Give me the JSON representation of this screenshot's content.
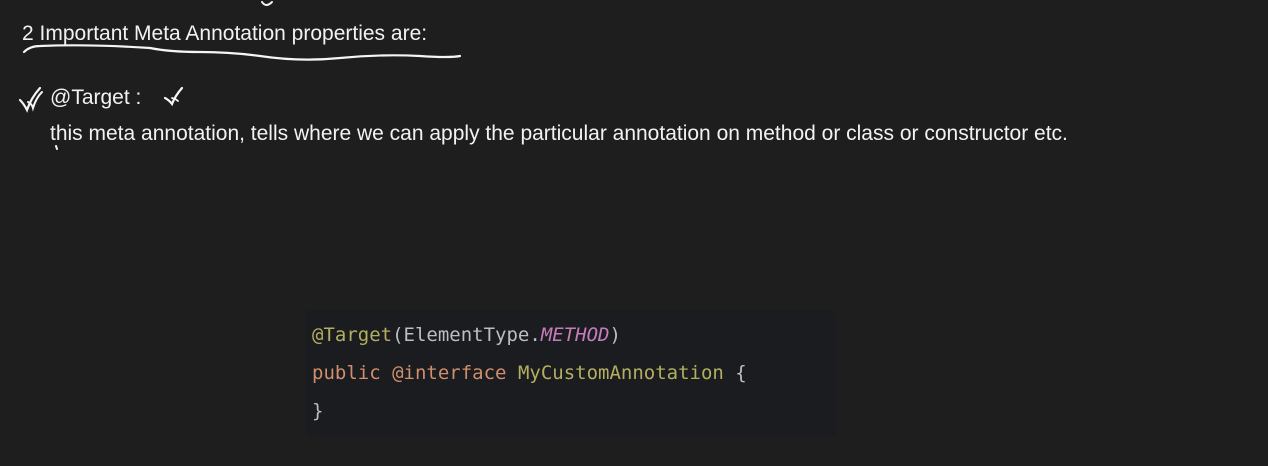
{
  "heading": {
    "text_underlined": "2 Important Meta Annotation properties",
    "text_rest": " are:"
  },
  "item": {
    "label": "@Target :",
    "description": "this meta annotation, tells where we can apply the particular annotation on method or class or constructor etc."
  },
  "code": {
    "line1": {
      "annotation": "@Target",
      "open_paren": "(",
      "type": "ElementType.",
      "constant": "METHOD",
      "close_paren": ")"
    },
    "line2": {
      "keyword": "public",
      "space1": " ",
      "interface_keyword": "@interface",
      "space2": " ",
      "name": "MyCustomAnnotation",
      "brace": " {"
    },
    "line3": {
      "brace": "}"
    }
  },
  "colors": {
    "background": "#1e1e1e",
    "text": "#f2f2f2",
    "code_background": "#1b1c1f",
    "annotation": "#b3ae60",
    "keyword": "#cf8e6d",
    "constant": "#c77dbb",
    "plain_code": "#bcbec4"
  },
  "icons": [
    "pen-tick-mark-icon",
    "pen-check-mark-icon"
  ]
}
